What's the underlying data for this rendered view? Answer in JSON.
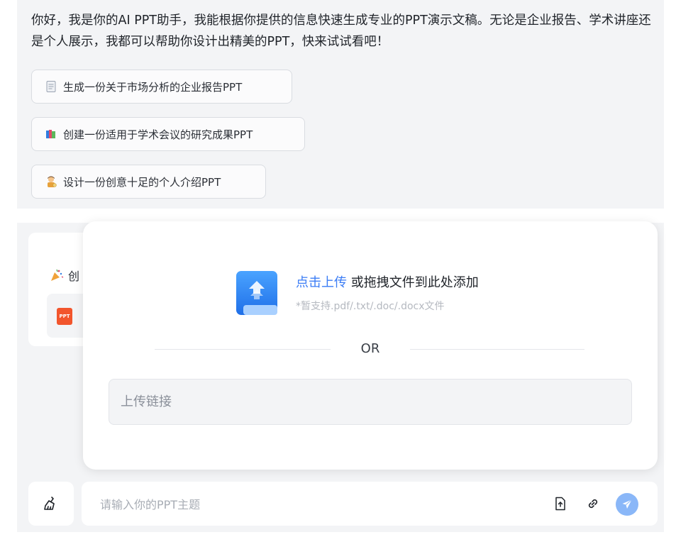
{
  "greeting": "你好，我是你的AI PPT助手，我能根据你提供的信息快速生成专业的PPT演示文稿。无论是企业报告、学术讲座还是个人展示，我都可以帮助你设计出精美的PPT，快来试试看吧！",
  "suggestions": [
    {
      "icon": "memo-icon",
      "label": "生成一份关于市场分析的企业报告PPT"
    },
    {
      "icon": "books-icon",
      "label": "创建一份适用于学术会议的研究成果PPT"
    },
    {
      "icon": "artist-icon",
      "label": "设计一份创意十足的个人介绍PPT"
    }
  ],
  "history": {
    "title_fragment": "创",
    "file_icon_label": "PPT"
  },
  "upload": {
    "link_text": "点击上传",
    "rest_text": " 或拖拽文件到此处添加",
    "hint": "*暂支持.pdf/.txt/.doc/.docx文件",
    "or_label": "OR",
    "link_placeholder": "上传链接"
  },
  "composer": {
    "placeholder": "请输入你的PPT主题"
  },
  "colors": {
    "accent": "#3a7cf5",
    "send": "#8ab7f8",
    "ppt": "#f2552c",
    "panel": "#f3f4f6"
  }
}
